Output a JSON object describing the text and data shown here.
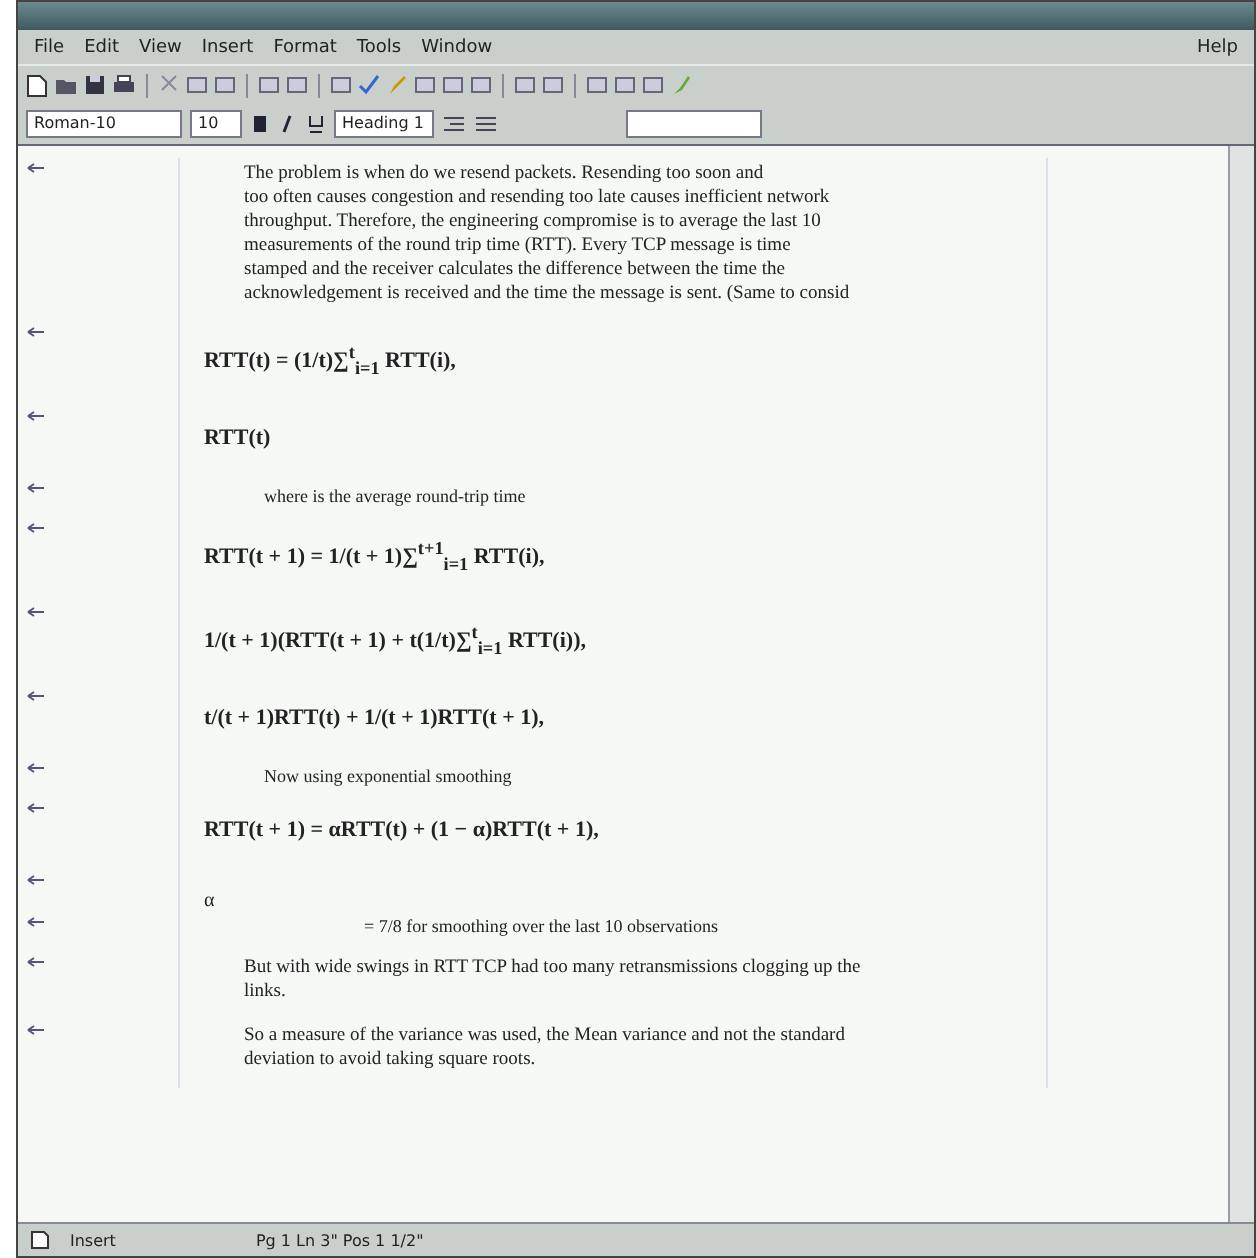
{
  "menu": {
    "items": [
      "File",
      "Edit",
      "View",
      "Insert",
      "Format",
      "Tools",
      "Window"
    ],
    "help": "Help"
  },
  "format_bar": {
    "font": "Roman-10",
    "size": "10",
    "style": "Heading 1"
  },
  "document": {
    "blocks": [
      {
        "kind": "paragraph",
        "lines": [
          "The problem is when do we resend packets. Resending too soon and",
          "too often causes congestion and resending too late causes inefficient network",
          "throughput.  Therefore, the engineering compromise is to average the last 10",
          "measurements of the round trip time (RTT). Every TCP message is time",
          "stamped and the receiver calculates the difference between the time the",
          "acknowledgement is received and the time the message is sent. (Same to consid"
        ]
      },
      {
        "kind": "formula",
        "text": "RTT(t) = (1/t)∑$^{t}$$_{i=1}$ RTT(i),"
      },
      {
        "kind": "formula",
        "text": "RTT(t)"
      },
      {
        "kind": "note",
        "text": "where  is the average round-trip time"
      },
      {
        "kind": "formula",
        "text": "RTT(t + 1) = 1/(t + 1)∑$^{t+1}$$_{i=1}$ RTT(i),"
      },
      {
        "kind": "formula",
        "text": "1/(t + 1)(RTT(t + 1) + t(1/t)∑$^{t}$$_{i=1}$ RTT(i)),"
      },
      {
        "kind": "formula",
        "text": "t/(t + 1)RTT(t) + 1/(t + 1)RTT(t + 1),"
      },
      {
        "kind": "note",
        "text": "Now using exponential smoothing"
      },
      {
        "kind": "formula",
        "text": "RTT(t + 1) = αRTT(t) + (1 − α)RTT(t + 1),"
      },
      {
        "kind": "symbol",
        "text": "α"
      },
      {
        "kind": "bullet",
        "text": "= 7/8 for smoothing over the last 10 observations"
      },
      {
        "kind": "paragraph",
        "lines": [
          "But with wide swings in RTT TCP had too many retransmissions clogging up the",
          "links."
        ]
      },
      {
        "kind": "paragraph",
        "lines": [
          "So a measure of the variance was used, the Mean variance and not the standard",
          "deviation to avoid taking square roots."
        ]
      }
    ]
  },
  "status_bar": {
    "mode": "Insert",
    "position": "Pg 1 Ln 3\" Pos 1 1/2\""
  }
}
